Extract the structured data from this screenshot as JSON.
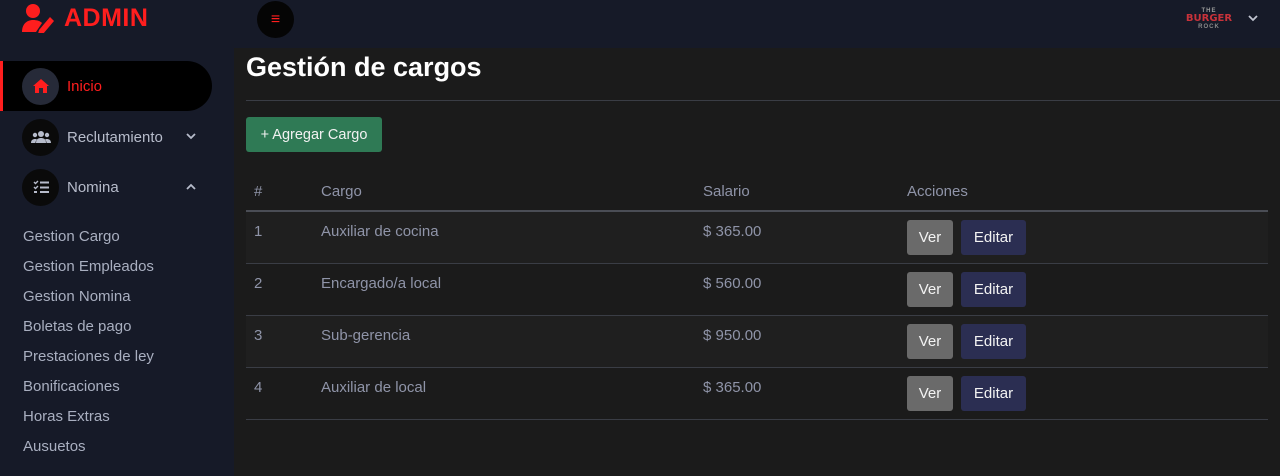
{
  "brand": {
    "title": "ADMIN"
  },
  "topbar": {
    "logo": {
      "top": "THE",
      "mid": "BURGER",
      "bottom": "ROCK"
    }
  },
  "sidebar": {
    "items": [
      {
        "label": "Inicio",
        "icon": "home-icon",
        "active": true
      },
      {
        "label": "Reclutamiento",
        "icon": "users-icon"
      },
      {
        "label": "Nomina",
        "icon": "list-check-icon"
      }
    ],
    "sub_items": [
      "Gestion Cargo",
      "Gestion Empleados",
      "Gestion Nomina",
      "Boletas de pago",
      "Prestaciones de ley",
      "Bonificaciones",
      "Horas Extras",
      "Ausuetos"
    ]
  },
  "main": {
    "title": "Gestión de cargos",
    "add_button": "+ Agregar Cargo",
    "table": {
      "headers": [
        "#",
        "Cargo",
        "Salario",
        "Acciones"
      ],
      "rows": [
        {
          "num": "1",
          "cargo": "Auxiliar de cocina",
          "salario": "$ 365.00"
        },
        {
          "num": "2",
          "cargo": "Encargado/a local",
          "salario": "$ 560.00"
        },
        {
          "num": "3",
          "cargo": "Sub-gerencia",
          "salario": "$ 950.00"
        },
        {
          "num": "4",
          "cargo": "Auxiliar de local",
          "salario": "$ 365.00"
        }
      ],
      "view_label": "Ver",
      "edit_label": "Editar"
    }
  },
  "colors": {
    "accent": "#ff1e1e",
    "sidebar_bg": "#161a28",
    "main_bg": "#1b1b1b",
    "add_button": "#2f7a55",
    "view_button": "#6a6a6a",
    "edit_button": "#2b2e52"
  }
}
